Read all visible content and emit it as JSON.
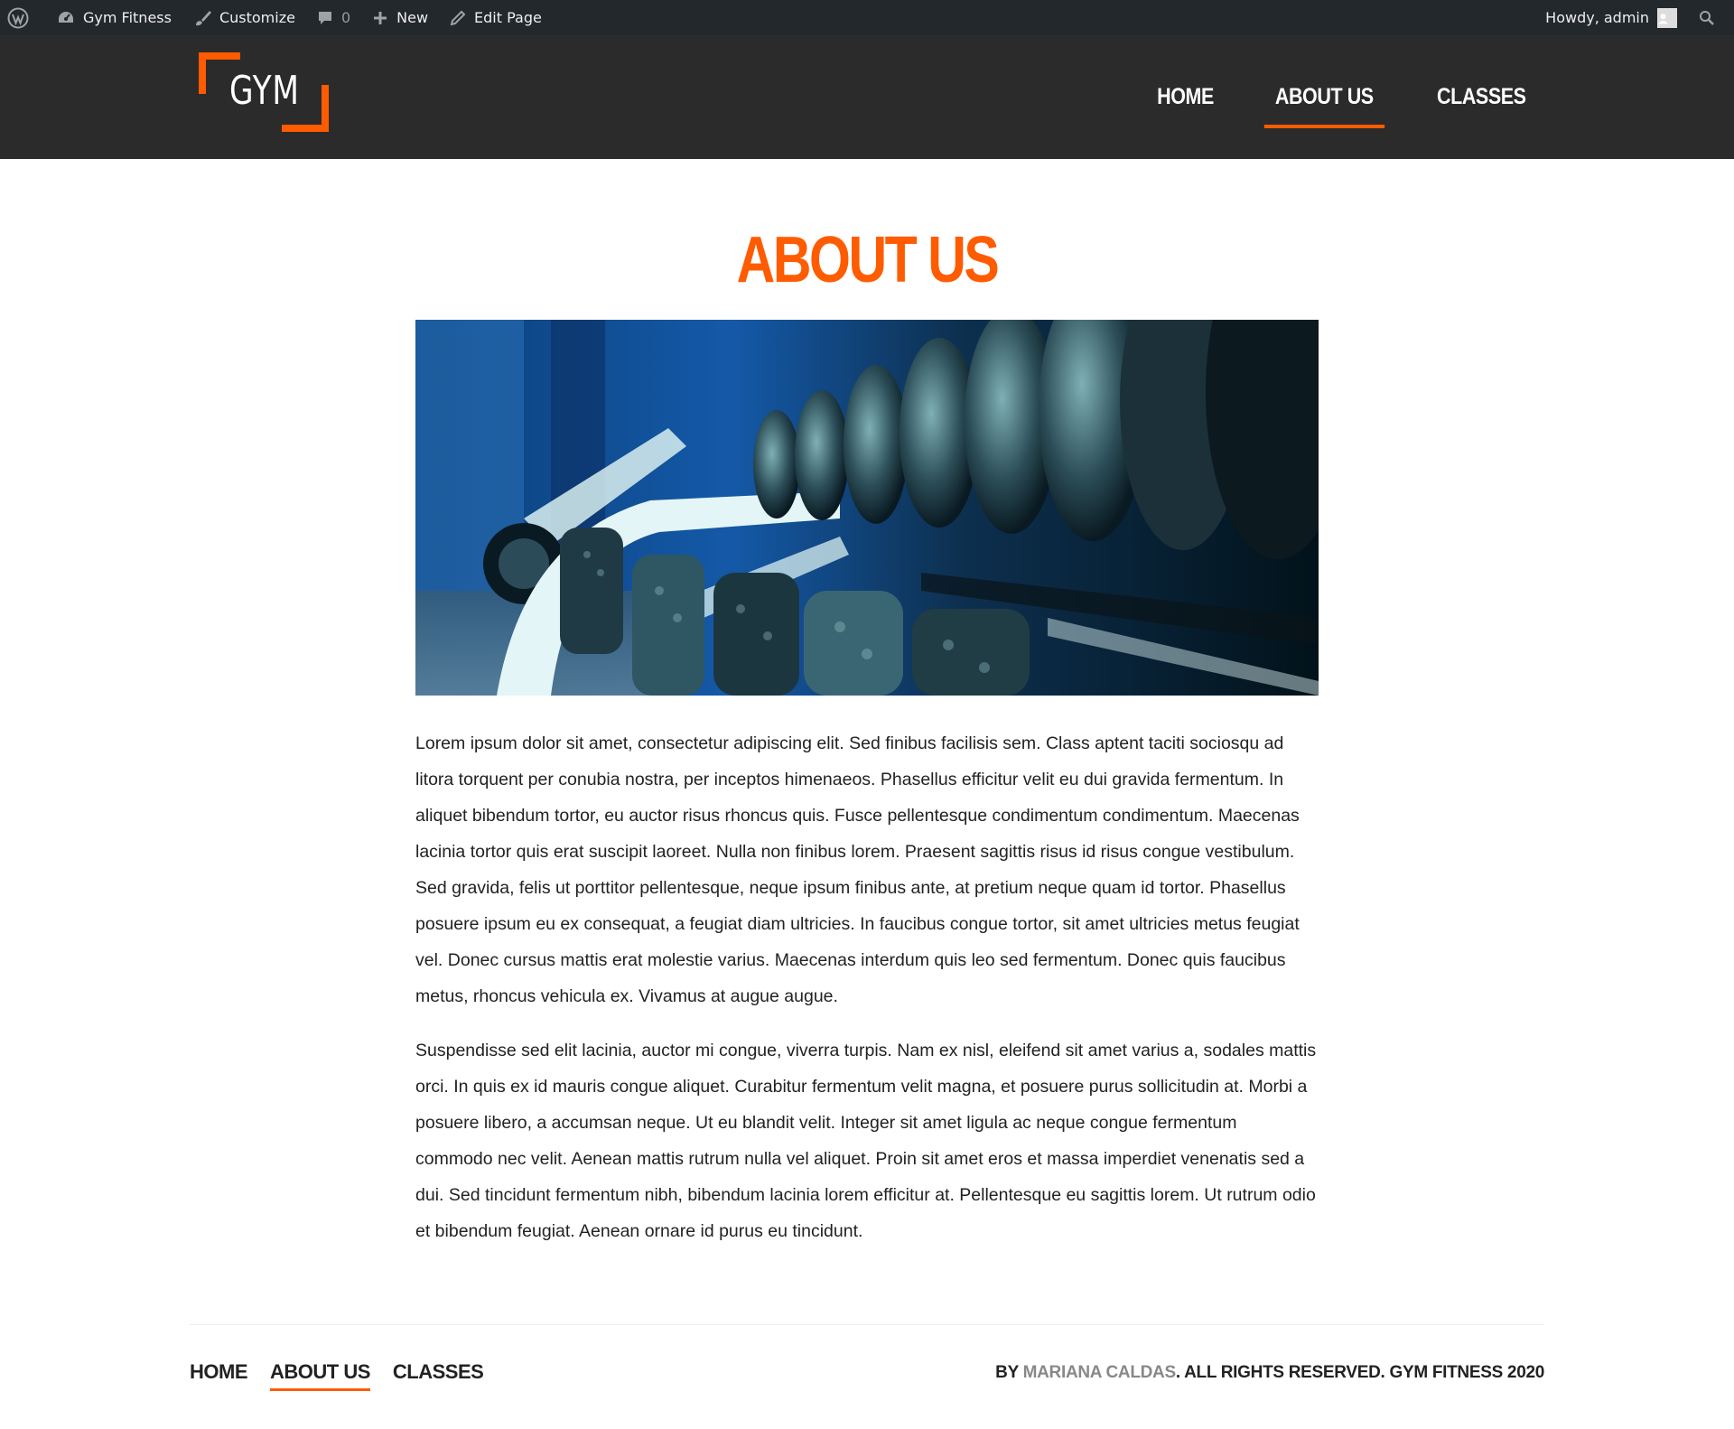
{
  "admin_bar": {
    "site_name": "Gym Fitness",
    "customize": "Customize",
    "comments_count": "0",
    "new": "New",
    "edit_page": "Edit Page",
    "howdy": "Howdy, admin"
  },
  "header": {
    "logo_text": "GYM",
    "nav": [
      "HOME",
      "ABOUT US",
      "CLASSES"
    ],
    "active_nav": "ABOUT US"
  },
  "page": {
    "title": "ABOUT US",
    "paragraphs": [
      "Lorem ipsum dolor sit amet, consectetur adipiscing elit. Sed finibus facilisis sem. Class aptent taciti sociosqu ad litora torquent per conubia nostra, per inceptos himenaeos. Phasellus efficitur velit eu dui gravida fermentum. In aliquet bibendum tortor, eu auctor risus rhoncus quis. Fusce pellentesque condimentum condimentum. Maecenas lacinia tortor quis erat suscipit laoreet. Nulla non finibus lorem. Praesent sagittis risus id risus congue vestibulum. Sed gravida, felis ut porttitor pellentesque, neque ipsum finibus ante, at pretium neque quam id tortor. Phasellus posuere ipsum eu ex consequat, a feugiat diam ultricies. In faucibus congue tortor, sit amet ultricies metus feugiat vel. Donec cursus mattis erat molestie varius. Maecenas interdum quis leo sed fermentum. Donec quis faucibus metus, rhoncus vehicula ex. Vivamus at augue augue.",
      "Suspendisse sed elit lacinia, auctor mi congue, viverra turpis. Nam ex nisl, eleifend sit amet varius a, sodales mattis orci. In quis ex id mauris congue aliquet. Curabitur fermentum velit magna, et posuere purus sollicitudin at. Morbi a posuere libero, a accumsan neque. Ut eu blandit velit. Integer sit amet ligula ac neque congue fermentum commodo nec velit. Aenean mattis rutrum nulla vel aliquet. Proin sit amet eros et massa imperdiet venenatis sed a dui. Sed tincidunt fermentum nibh, bibendum lacinia lorem efficitur at. Pellentesque eu sagittis lorem. Ut rutrum odio et bibendum feugiat. Aenean ornare id purus eu tincidunt."
    ]
  },
  "footer": {
    "nav": [
      "HOME",
      "ABOUT US",
      "CLASSES"
    ],
    "copyright_prefix": "BY ",
    "author": "MARIANA CALDAS",
    "copyright_suffix": ". ALL RIGHTS RESERVED. GYM FITNESS 2020"
  },
  "colors": {
    "accent": "#ff5b00",
    "header_bg": "#2b2b2b",
    "admin_bar_bg": "#23282d"
  },
  "icons": [
    "wordpress-icon",
    "dashboard-icon",
    "brush-icon",
    "comment-icon",
    "plus-icon",
    "pencil-icon",
    "user-avatar-icon",
    "search-icon"
  ]
}
